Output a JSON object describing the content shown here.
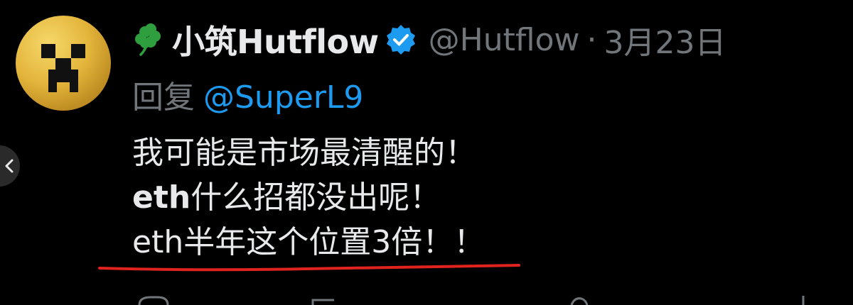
{
  "tweet": {
    "display_name": "小筑Hutflow",
    "handle": "@Hutflow",
    "separator": "·",
    "date": "3月23日",
    "reply_label": "回复",
    "reply_target": "@SuperL9",
    "lines": [
      {
        "plain": "我可能是市场最清醒的！"
      },
      {
        "bold": "eth",
        "rest": "什么招都没出呢！"
      },
      {
        "plain": "eth半年这个位置3倍！！"
      }
    ]
  },
  "colors": {
    "background": "#000000",
    "text": "#e7e9ea",
    "muted": "#71767b",
    "link": "#1d9bf0",
    "verified": "#1d9bf0",
    "clover": "#2e9e3e",
    "annotation_underline": "#e0231f"
  },
  "icons": {
    "avatar": "creeper-face-avatar",
    "name_emoji": "four-leaf-clover-icon",
    "verified": "verified-badge-icon",
    "back": "chevron-left-icon"
  }
}
